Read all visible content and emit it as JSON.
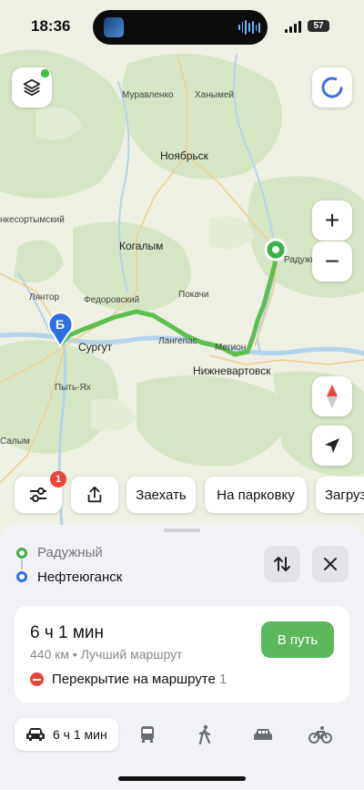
{
  "status": {
    "time": "18:36",
    "battery": "57"
  },
  "map": {
    "cities": [
      {
        "name": "Ноябрьск",
        "big": true
      },
      {
        "name": "Муравленко",
        "big": false
      },
      {
        "name": "Ханымей",
        "big": false
      },
      {
        "name": "Когалым",
        "big": true
      },
      {
        "name": "Федоровский",
        "big": false
      },
      {
        "name": "Покачи",
        "big": false
      },
      {
        "name": "Лянтор",
        "big": false
      },
      {
        "name": "Сургут",
        "big": true
      },
      {
        "name": "Лангепас",
        "big": false
      },
      {
        "name": "Мегион",
        "big": false
      },
      {
        "name": "Нижневартовск",
        "big": true
      },
      {
        "name": "Пыть-Ях",
        "big": false
      },
      {
        "name": "Салым",
        "big": false
      },
      {
        "name": "Радужный",
        "big": false
      },
      {
        "name": "нкесортымский",
        "big": false
      }
    ],
    "dest_marker": "Б",
    "zoom_in": "+",
    "zoom_out": "−",
    "layers_badge_color": "#3cc13b",
    "route_color": "#5cc04f"
  },
  "chips": {
    "settings_badge": "1",
    "items": [
      {
        "label": "Заехать"
      },
      {
        "label": "На парковку"
      },
      {
        "label": "Загрузить"
      }
    ]
  },
  "route": {
    "from": "Радужный",
    "to": "Нефтеюганск",
    "from_color": "#3cb043",
    "to_color": "#2f6fe4"
  },
  "summary": {
    "duration": "6 ч 1 мин",
    "distance": "440 км",
    "separator": " • ",
    "route_type": "Лучший маршрут",
    "go_button": "В путь",
    "warning_text": "Перекрытие на маршруте",
    "warning_count": "1"
  },
  "modes": {
    "active_label": "6 ч 1 мин",
    "icons": [
      "car-icon",
      "bus-icon",
      "walk-icon",
      "taxi-icon",
      "bike-icon"
    ]
  }
}
